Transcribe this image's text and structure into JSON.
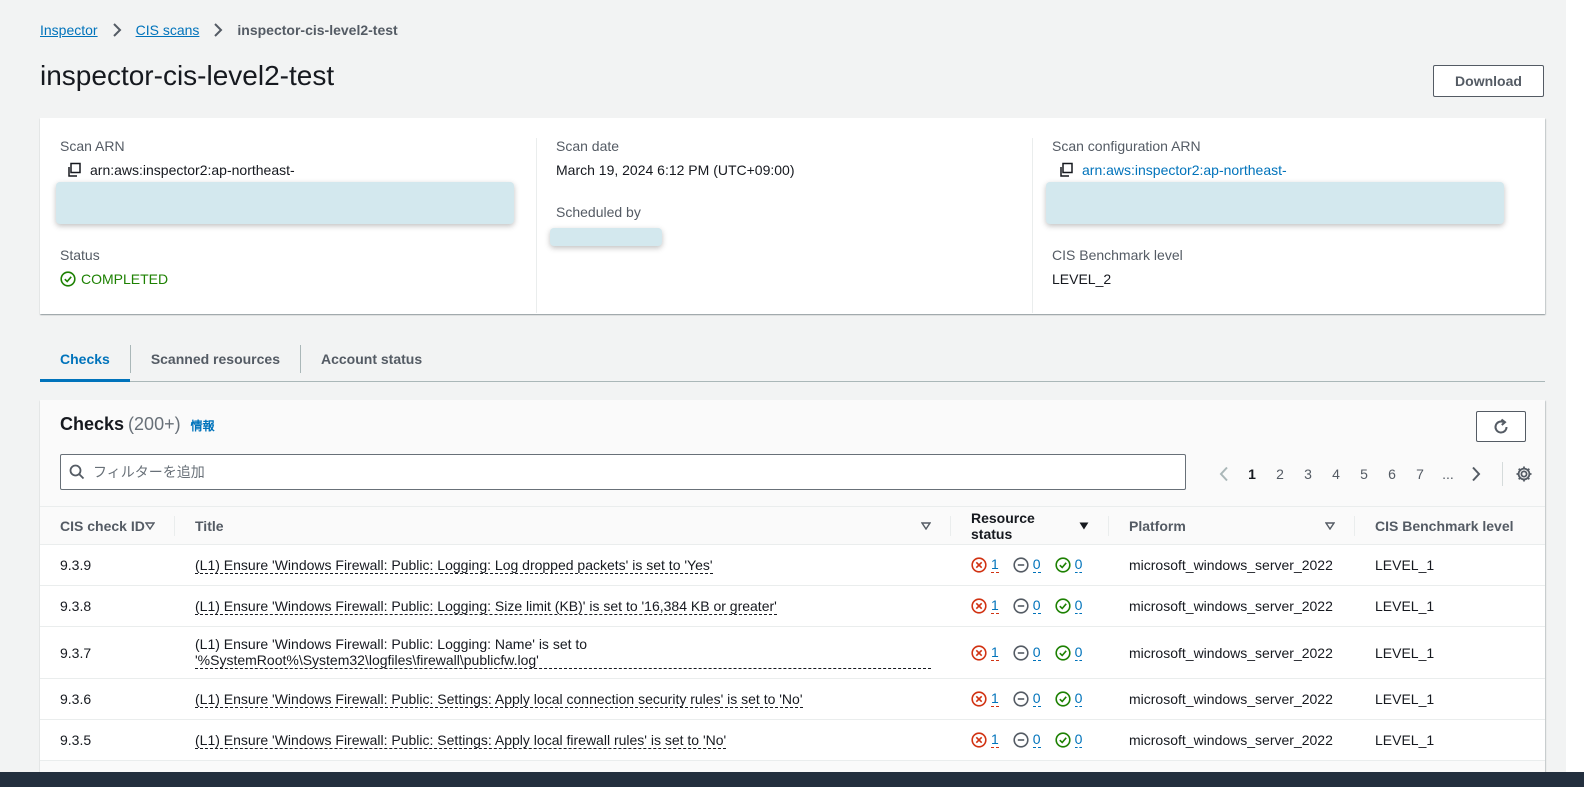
{
  "breadcrumb": {
    "items": [
      "Inspector",
      "CIS scans"
    ],
    "current": "inspector-cis-level2-test"
  },
  "page": {
    "title": "inspector-cis-level2-test",
    "download_label": "Download"
  },
  "details": {
    "scan_arn_label": "Scan ARN",
    "scan_arn_value": "arn:aws:inspector2:ap-northeast-",
    "status_label": "Status",
    "status_value": "COMPLETED",
    "scan_date_label": "Scan date",
    "scan_date_value": "March 19, 2024 6:12 PM (UTC+09:00)",
    "scheduled_by_label": "Scheduled by",
    "config_arn_label": "Scan configuration ARN",
    "config_arn_value": "arn:aws:inspector2:ap-northeast-",
    "benchmark_label": "CIS Benchmark level",
    "benchmark_value": "LEVEL_2"
  },
  "tabs": [
    {
      "label": "Checks",
      "active": true
    },
    {
      "label": "Scanned resources",
      "active": false
    },
    {
      "label": "Account status",
      "active": false
    }
  ],
  "checks": {
    "title": "Checks",
    "count": "(200+)",
    "info_label": "情報",
    "filter_placeholder": "フィルターを追加",
    "pages": [
      "1",
      "2",
      "3",
      "4",
      "5",
      "6",
      "7",
      "..."
    ],
    "current_page": "1",
    "columns": [
      "CIS check ID",
      "Title",
      "Resource status",
      "Platform",
      "CIS Benchmark level"
    ],
    "rows": [
      {
        "id": "9.3.9",
        "title": "(L1) Ensure 'Windows Firewall: Public: Logging: Log dropped packets' is set to 'Yes'",
        "failed": "1",
        "skipped": "0",
        "passed": "0",
        "platform": "microsoft_windows_server_2022",
        "level": "LEVEL_1"
      },
      {
        "id": "9.3.8",
        "title": "(L1) Ensure 'Windows Firewall: Public: Logging: Size limit (KB)' is set to '16,384 KB or greater'",
        "failed": "1",
        "skipped": "0",
        "passed": "0",
        "platform": "microsoft_windows_server_2022",
        "level": "LEVEL_1"
      },
      {
        "id": "9.3.7",
        "title": "(L1) Ensure 'Windows Firewall: Public: Logging: Name' is set to '%SystemRoot%\\System32\\logfiles\\firewall\\publicfw.log'",
        "failed": "1",
        "skipped": "0",
        "passed": "0",
        "platform": "microsoft_windows_server_2022",
        "level": "LEVEL_1"
      },
      {
        "id": "9.3.6",
        "title": "(L1) Ensure 'Windows Firewall: Public: Settings: Apply local connection security rules' is set to 'No'",
        "failed": "1",
        "skipped": "0",
        "passed": "0",
        "platform": "microsoft_windows_server_2022",
        "level": "LEVEL_1"
      },
      {
        "id": "9.3.5",
        "title": "(L1) Ensure 'Windows Firewall: Public: Settings: Apply local firewall rules' is set to 'No'",
        "failed": "1",
        "skipped": "0",
        "passed": "0",
        "platform": "microsoft_windows_server_2022",
        "level": "LEVEL_1"
      }
    ]
  },
  "colors": {
    "link": "#0073bb",
    "success": "#1d8102",
    "error": "#d13212",
    "redaction": "#d3e8ee"
  }
}
